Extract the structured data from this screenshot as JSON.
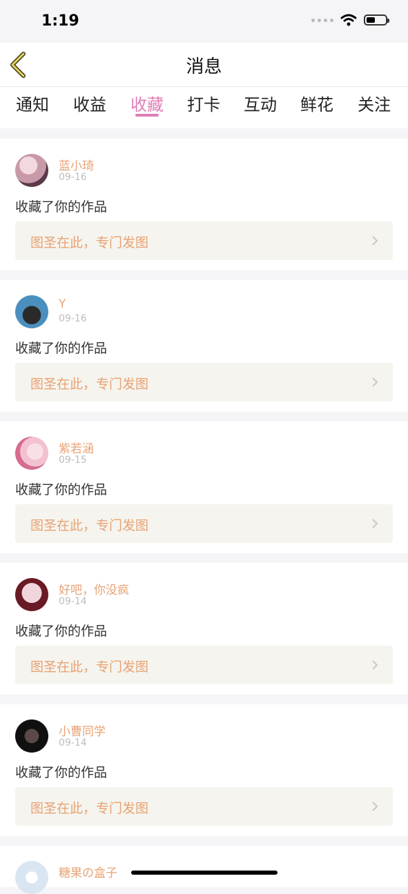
{
  "status_bar": {
    "time": "1:19"
  },
  "header": {
    "title": "消息"
  },
  "tabs": [
    "通知",
    "收益",
    "收藏",
    "打卡",
    "互动",
    "鲜花",
    "关注"
  ],
  "active_tab": "收藏",
  "items": [
    {
      "user": "蓝小琦",
      "date": "09-16",
      "action": "收藏了你的作品",
      "work": "图圣在此，专门发图",
      "avatar_colors": [
        "#c89aa8",
        "#5a3a4a"
      ]
    },
    {
      "user": "Y",
      "date": "09-16",
      "action": "收藏了你的作品",
      "work": "图圣在此，专门发图",
      "avatar_colors": [
        "#4b8fbf",
        "#2a2a2a"
      ]
    },
    {
      "user": "紫若涵",
      "date": "09-15",
      "action": "收藏了你的作品",
      "work": "图圣在此，专门发图",
      "avatar_colors": [
        "#f3c1cf",
        "#d56b8f"
      ]
    },
    {
      "user": "好吧，你没疯",
      "date": "09-14",
      "action": "收藏了你的作品",
      "work": "图圣在此，专门发图",
      "avatar_colors": [
        "#f1d5dc",
        "#6a1a24"
      ]
    },
    {
      "user": "小曹同学",
      "date": "09-14",
      "action": "收藏了你的作品",
      "work": "图圣在此，专门发图",
      "avatar_colors": [
        "#3a2f2f",
        "#101010"
      ]
    },
    {
      "user": "糖果の盒子",
      "date": "",
      "action": "",
      "work": "",
      "avatar_colors": [
        "#d9e6f2",
        "#a8c1d9"
      ]
    }
  ],
  "colors": {
    "accent": "#e07eb5",
    "username": "#e8a274",
    "link_bg": "#f5f4ee",
    "back_arrow": "#c9a63a"
  }
}
